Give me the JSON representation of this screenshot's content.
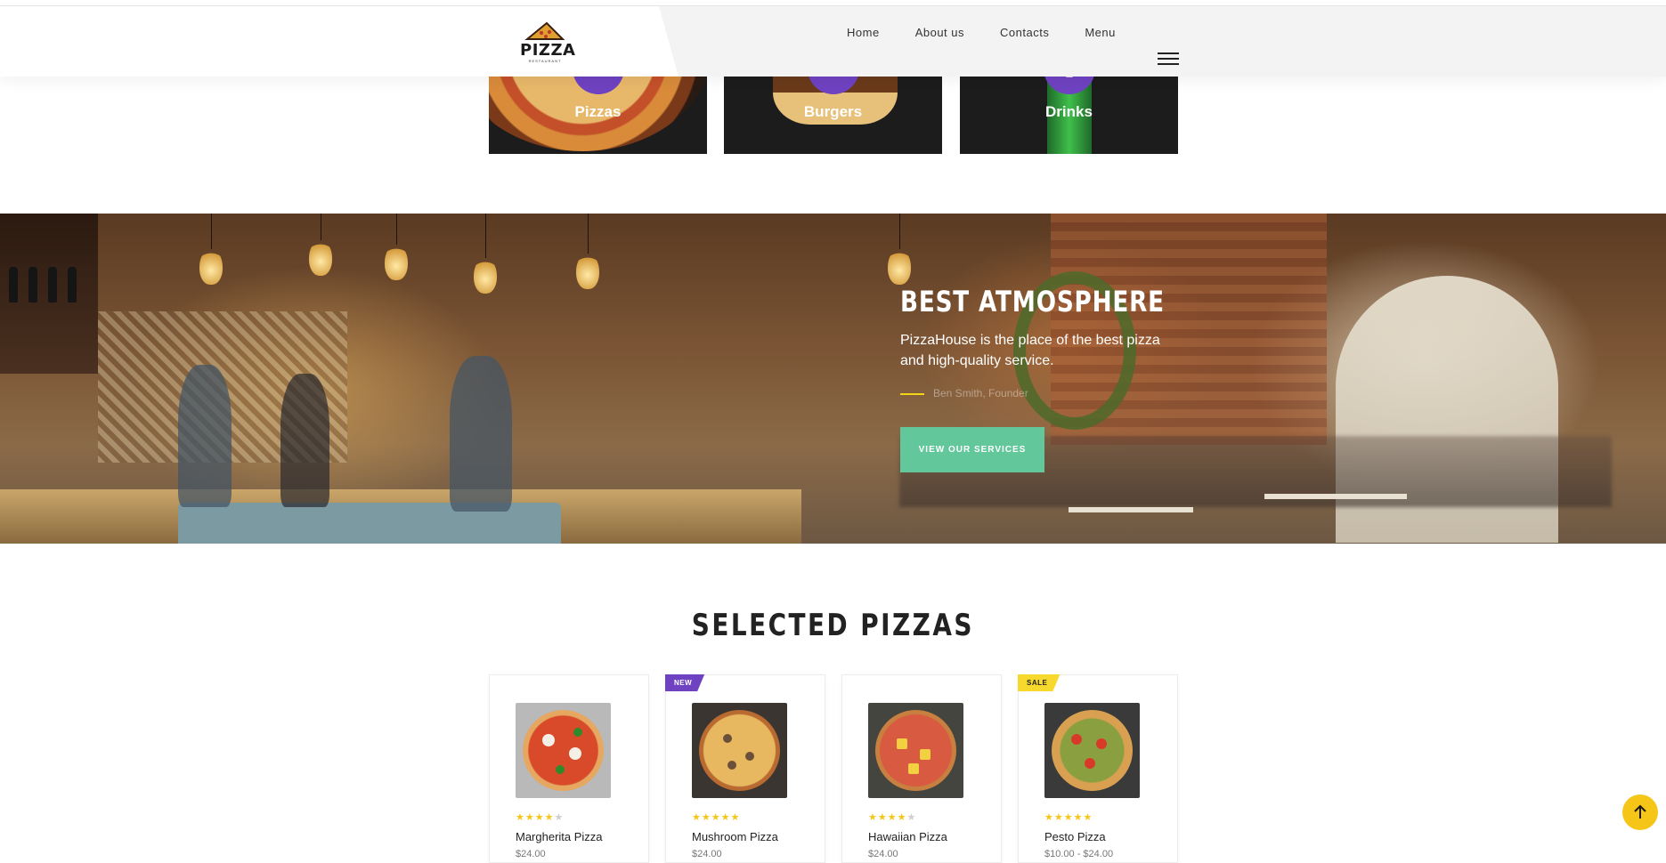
{
  "header": {
    "logo_text": "PIZZA",
    "logo_sub": "RESTAURANT",
    "nav": [
      "Home",
      "About us",
      "Contacts",
      "Menu"
    ]
  },
  "categories": [
    {
      "label": "Pizzas",
      "icon": "pizza-slice-icon"
    },
    {
      "label": "Burgers",
      "icon": "burger-icon"
    },
    {
      "label": "Drinks",
      "icon": "drink-cup-icon"
    }
  ],
  "hero": {
    "title": "BEST ATMOSPHERE",
    "text": "PizzaHouse is the place of the best pizza and high-quality service.",
    "author": "Ben Smith, Founder",
    "button": "VIEW OUR SERVICES"
  },
  "pizzas": {
    "title": "SELECTED PIZZAS",
    "items": [
      {
        "name": "Margherita Pizza",
        "rating": 4,
        "price": "$24.00",
        "badge": ""
      },
      {
        "name": "Mushroom Pizza",
        "rating": 5,
        "price": "$24.00",
        "badge": "NEW"
      },
      {
        "name": "Hawaiian Pizza",
        "rating": 4,
        "price": "$24.00",
        "badge": ""
      },
      {
        "name": "Pesto Pizza",
        "rating": 5,
        "price": "$10.00 - $24.00",
        "badge": "SALE"
      }
    ]
  },
  "colors": {
    "accent_purple": "#6f42c1",
    "accent_green": "#62c79a",
    "accent_yellow": "#f5c518"
  },
  "icons": {
    "back_to_top": "arrow-up-icon",
    "menu": "hamburger-menu-icon"
  }
}
